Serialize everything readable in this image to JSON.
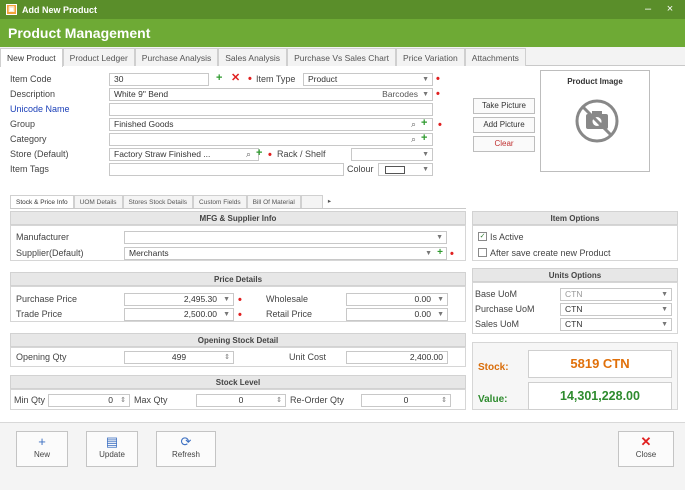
{
  "window": {
    "title": "Add New Product",
    "minimize": "–",
    "close": "×"
  },
  "header": {
    "title": "Product Management"
  },
  "tabs": [
    "New Product",
    "Product Ledger",
    "Purchase Analysis",
    "Sales Analysis",
    "Purchase Vs Sales Chart",
    "Price Variation",
    "Attachments"
  ],
  "form": {
    "item_code_label": "Item Code",
    "item_code": "30",
    "item_type_label": "Item Type",
    "item_type": "Product",
    "description_label": "Description",
    "description": "White 9\" Bend",
    "barcodes": "Barcodes",
    "unicode_name_label": "Unicode Name",
    "unicode_name": "",
    "group_label": "Group",
    "group": "Finished Goods",
    "category_label": "Category",
    "category": "",
    "store_label": "Store (Default)",
    "store": "Factory Straw Finished ...",
    "rack_label": "Rack / Shelf",
    "rack": "",
    "tags_label": "Item Tags",
    "tags": "",
    "colour_label": "Colour"
  },
  "image": {
    "caption": "Product Image",
    "take_picture": "Take Picture",
    "add_picture": "Add Picture",
    "clear": "Clear"
  },
  "subtabs": [
    "Stock & Price Info",
    "UOM Details",
    "Stores Stock Details",
    "Custom Fields",
    "Bill Of Material",
    "",
    "▸"
  ],
  "mfg": {
    "title": "MFG & Supplier Info",
    "manufacturer_label": "Manufacturer",
    "manufacturer": "",
    "supplier_label": "Supplier(Default)",
    "supplier": "Merchants"
  },
  "price": {
    "title": "Price Details",
    "purchase_label": "Purchase Price",
    "purchase": "2,495.30",
    "trade_label": "Trade Price",
    "trade": "2,500.00",
    "wholesale_label": "Wholesale",
    "wholesale": "0.00",
    "retail_label": "Retail Price",
    "retail": "0.00"
  },
  "opening": {
    "title": "Opening Stock Detail",
    "qty_label": "Opening Qty",
    "qty": "499",
    "cost_label": "Unit Cost",
    "cost": "2,400.00"
  },
  "stock_level": {
    "title": "Stock Level",
    "min_label": "Min Qty",
    "min": "0",
    "max_label": "Max Qty",
    "max": "0",
    "reorder_label": "Re-Order Qty",
    "reorder": "0"
  },
  "item_options": {
    "title": "Item Options",
    "is_active": "Is Active",
    "after_save": "After save create new Product"
  },
  "units": {
    "title": "Units Options",
    "base_label": "Base UoM",
    "base": "CTN",
    "purchase_label": "Purchase UoM",
    "purchase": "CTN",
    "sales_label": "Sales UoM",
    "sales": "CTN"
  },
  "stats": {
    "stock_label": "Stock:",
    "stock_value": "5819 CTN",
    "value_label": "Value:",
    "value_value": "14,301,228.00"
  },
  "buttons": {
    "new": "New",
    "update": "Update",
    "refresh": "Refresh",
    "close": "Close"
  },
  "colors": {
    "title_bar": "#5a8e2a",
    "header": "#6eaa35",
    "stock_value": "#e0700a",
    "money_value": "#2e8b2e",
    "required": "#e02020"
  },
  "icons": {
    "new": "plus-icon",
    "update": "save-icon",
    "refresh": "refresh-icon",
    "close": "close-icon",
    "no_image": "camera-off-icon"
  }
}
